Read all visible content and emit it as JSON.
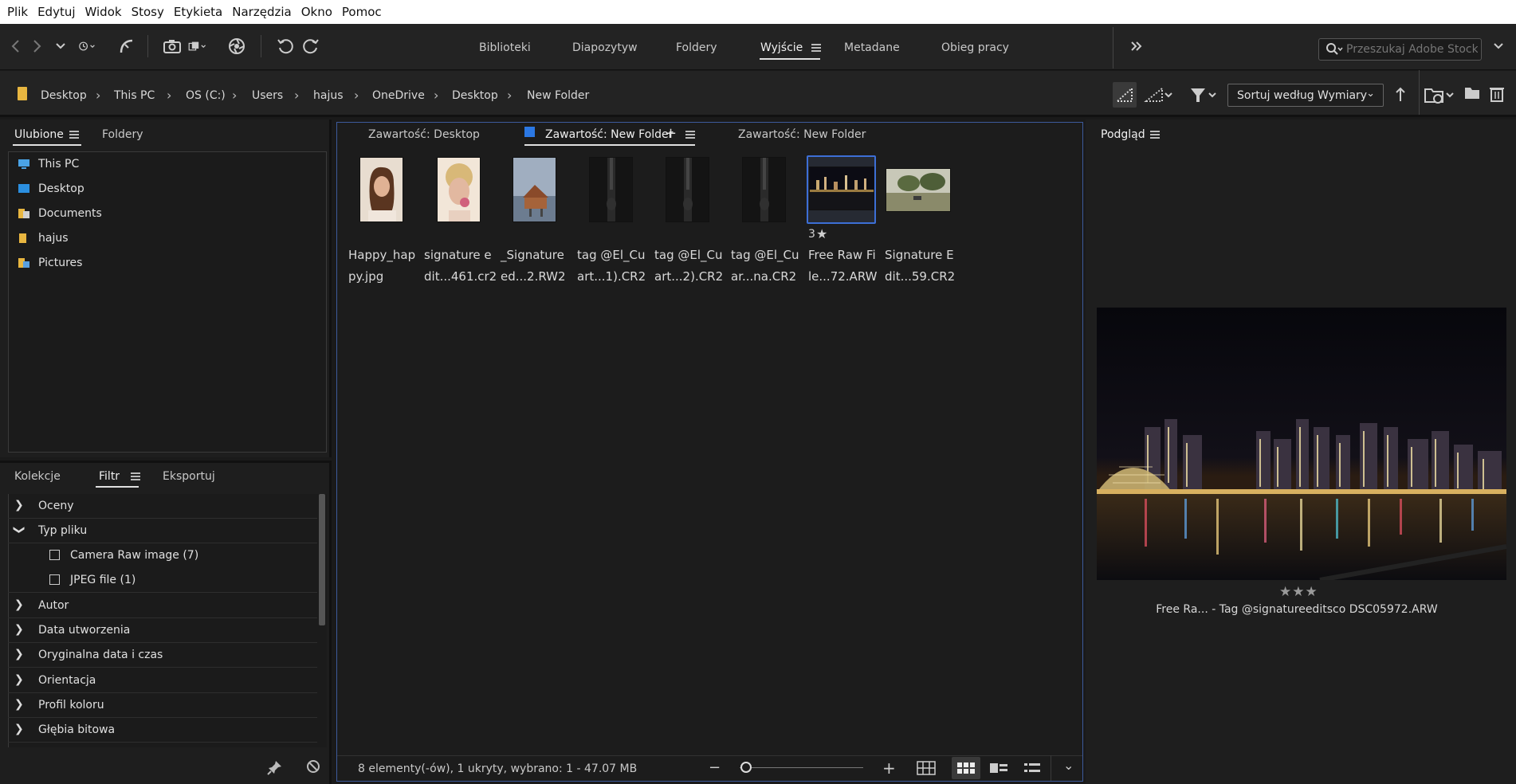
{
  "menu": [
    "Plik",
    "Edytuj",
    "Widok",
    "Stosy",
    "Etykieta",
    "Narzędzia",
    "Okno",
    "Pomoc"
  ],
  "workspaces": [
    "Biblioteki",
    "Diapozytyw",
    "Foldery",
    "Wyjście",
    "Metadane",
    "Obieg pracy"
  ],
  "active_workspace": "Wyjście",
  "search": {
    "placeholder": "Przeszukaj Adobe Stock"
  },
  "breadcrumb": [
    "Desktop",
    "This PC",
    "OS (C:)",
    "Users",
    "hajus",
    "OneDrive",
    "Desktop",
    "New Folder"
  ],
  "sort": {
    "label": "Sortuj według Wymiary"
  },
  "left_top": {
    "tabs": [
      "Ulubione",
      "Foldery"
    ],
    "favorites": [
      {
        "label": "This PC",
        "icon": "pc-icon"
      },
      {
        "label": "Desktop",
        "icon": "desktop-folder-icon"
      },
      {
        "label": "Documents",
        "icon": "documents-folder-icon"
      },
      {
        "label": "hajus",
        "icon": "user-folder-icon"
      },
      {
        "label": "Pictures",
        "icon": "pictures-folder-icon"
      }
    ]
  },
  "left_bottom": {
    "tabs": [
      "Kolekcje",
      "Filtr",
      "Eksportuj"
    ],
    "filters": [
      {
        "label": "Oceny",
        "expanded": false
      },
      {
        "label": "Typ pliku",
        "expanded": true
      },
      {
        "label": "Camera Raw image  (7)",
        "sub": true
      },
      {
        "label": "JPEG file  (1)",
        "sub": true
      },
      {
        "label": "Autor",
        "expanded": false
      },
      {
        "label": "Data utworzenia",
        "expanded": false
      },
      {
        "label": "Oryginalna data i czas",
        "expanded": false
      },
      {
        "label": "Orientacja",
        "expanded": false
      },
      {
        "label": "Profil koloru",
        "expanded": false
      },
      {
        "label": "Głębia bitowa",
        "expanded": false
      }
    ]
  },
  "content_tabs": [
    "Zawartość: Desktop",
    "Zawartość: New Folder",
    "Zawartość: New Folder"
  ],
  "thumbnails": [
    {
      "line1": "Happy_hap",
      "line2": "py.jpg"
    },
    {
      "line1": "signature e",
      "line2": "dit...461.cr2"
    },
    {
      "line1": "_Signature",
      "line2": "ed...2.RW2"
    },
    {
      "line1": "tag @El_Cu",
      "line2": "art...1).CR2"
    },
    {
      "line1": "tag @El_Cu",
      "line2": "art...2).CR2"
    },
    {
      "line1": "tag @El_Cu",
      "line2": "ar...na.CR2"
    },
    {
      "line1": "Free Raw Fi",
      "line2": "le...72.ARW",
      "rating": "3",
      "selected": true
    },
    {
      "line1": "Signature E",
      "line2": "dit...59.CR2"
    }
  ],
  "status": "8 elementy(-ów), 1 ukryty, wybrano: 1 - 47.07 MB",
  "preview": {
    "tab": "Podgląd",
    "stars": "★★★",
    "caption": "Free Ra... - Tag @signatureeditsco DSC05972.ARW"
  },
  "colors": {
    "accent": "#3d6fd6",
    "panel": "#1e1e1e",
    "background": "#111111"
  }
}
